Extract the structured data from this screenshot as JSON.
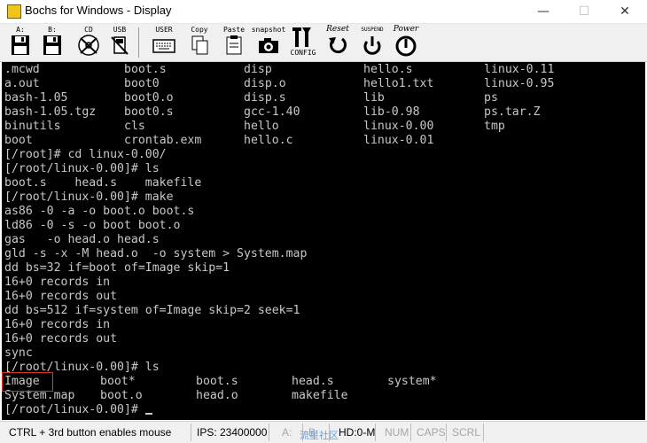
{
  "window": {
    "title": "Bochs for Windows - Display",
    "minimize_glyph": "—",
    "maximize_glyph": "☐",
    "close_glyph": "✕"
  },
  "toolbar": {
    "floppy_a": "A:",
    "floppy_b": "B:",
    "cdrom": "CD",
    "usb": "USB",
    "user": "USER",
    "copy": "Copy",
    "paste": "Paste",
    "snapshot": "snapshot",
    "config": "CONFIG",
    "reset": "Reset",
    "suspend": "SUSPEND",
    "power": "Power"
  },
  "terminal": {
    "listing": [
      [
        ".mcwd",
        "boot.s",
        "disp",
        "hello.s",
        "linux-0.11"
      ],
      [
        "a.out",
        "boot0",
        "disp.o",
        "hello1.txt",
        "linux-0.95"
      ],
      [
        "bash-1.05",
        "boot0.o",
        "disp.s",
        "lib",
        "ps"
      ],
      [
        "bash-1.05.tgz",
        "boot0.s",
        "gcc-1.40",
        "lib-0.98",
        "ps.tar.Z"
      ],
      [
        "binutils",
        "cls",
        "hello",
        "linux-0.00",
        "tmp"
      ],
      [
        "boot",
        "crontab.exm",
        "hello.c",
        "linux-0.01",
        ""
      ]
    ],
    "lines": [
      "[/root]# cd linux-0.00/",
      "[/root/linux-0.00]# ls",
      "boot.s    head.s    makefile",
      "[/root/linux-0.00]# make",
      "as86 -0 -a -o boot.o boot.s",
      "ld86 -0 -s -o boot boot.o",
      "gas   -o head.o head.s",
      "gld -s -x -M head.o  -o system > System.map",
      "dd bs=32 if=boot of=Image skip=1",
      "16+0 records in",
      "16+0 records out",
      "dd bs=512 if=system of=Image skip=2 seek=1",
      "16+0 records in",
      "16+0 records out",
      "sync",
      "[/root/linux-0.00]# ls"
    ],
    "final_listing": [
      [
        "Image",
        "boot*",
        "boot.s",
        "head.s",
        "system*"
      ],
      [
        "System.map",
        "boot.o",
        "head.o",
        "makefile",
        ""
      ]
    ],
    "prompt": "[/root/linux-0.00]# "
  },
  "statusbar": {
    "hint": "CTRL + 3rd button enables mouse",
    "ips": "IPS:  23400000",
    "a_drive": "A:",
    "b_drive": "B:",
    "hd_drive": "HD:0-M",
    "num": "NUM",
    "caps": "CAPS",
    "scrl": "SCRL"
  },
  "watermark": "流星社区"
}
